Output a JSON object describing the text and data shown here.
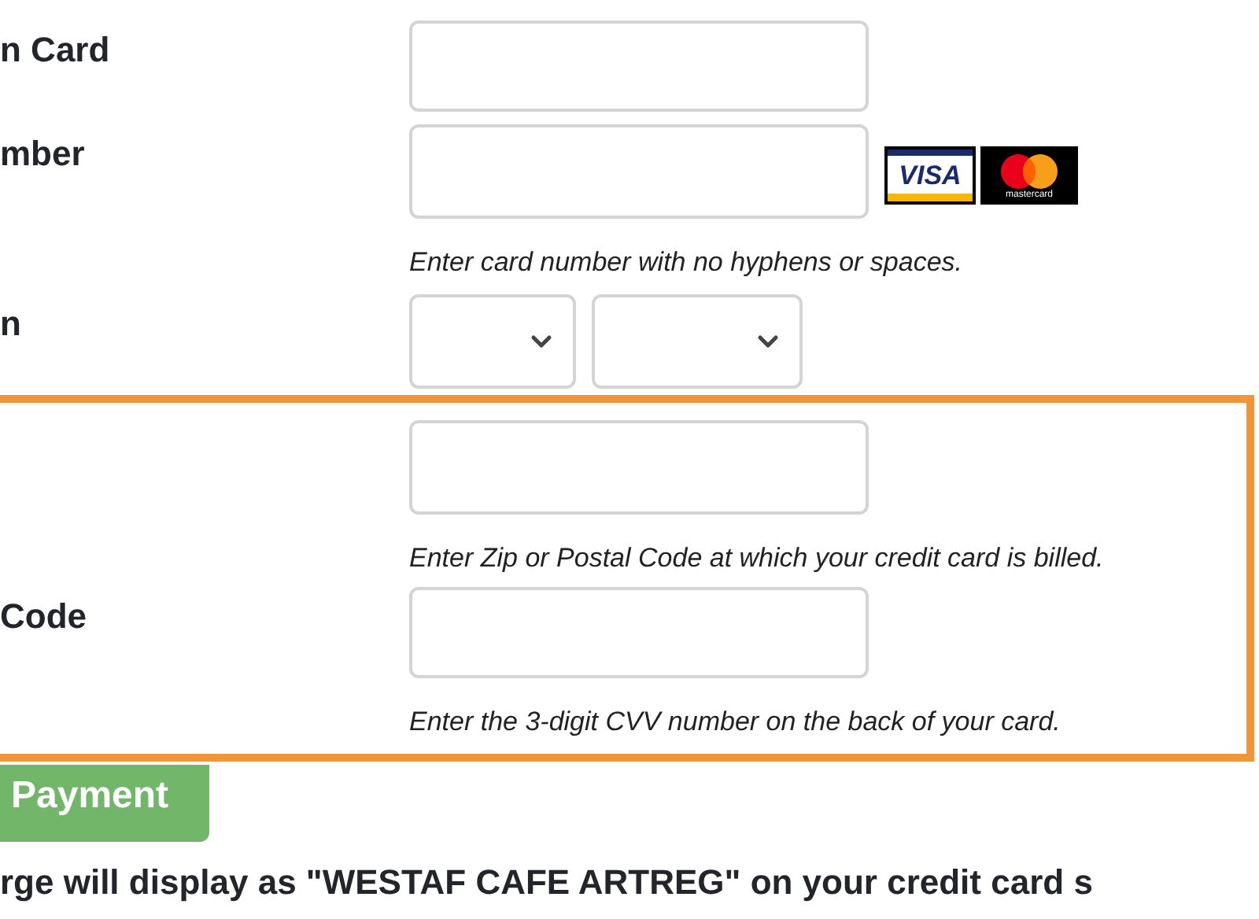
{
  "card_form": {
    "rows": [
      {
        "kind": "text",
        "label": "n Card"
      },
      {
        "kind": "text",
        "label": "mber",
        "logos": [
          {
            "kind": "visa",
            "text": "VISA"
          },
          {
            "kind": "mastercard",
            "text": "mastercard"
          }
        ],
        "help": "Enter card number with no hyphens or spaces."
      },
      {
        "kind": "date",
        "label": "n"
      }
    ]
  },
  "highlighted_section": {
    "rows": [
      {
        "kind": "text",
        "help": "Enter Zip or Postal Code at which your credit card is billed."
      },
      {
        "kind": "text",
        "label": "Code",
        "help": "Enter the 3-digit CVV number on the back of your card."
      }
    ]
  },
  "submit_button": {
    "label": "Payment"
  },
  "notice": "rge will display as \"WESTAF CAFE ARTREG\" on your credit card s"
}
